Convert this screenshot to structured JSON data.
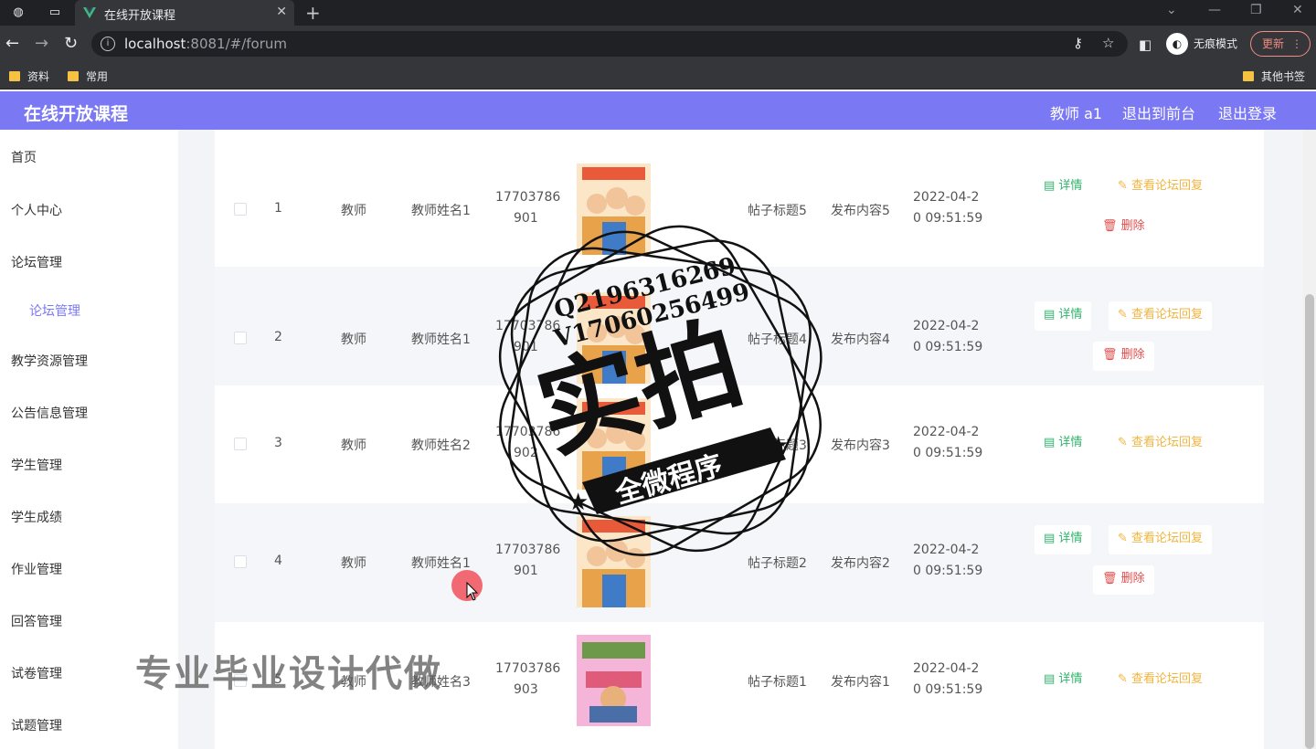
{
  "browser": {
    "tab_title": "在线开放课程",
    "url_host": "localhost",
    "url_rest": ":8081/#/forum",
    "incognito_label": "无痕模式",
    "update_label": "更新",
    "bookmarks": [
      "资料",
      "常用"
    ],
    "other_bookmarks": "其他书签"
  },
  "header": {
    "title": "在线开放课程",
    "user": "教师 a1",
    "to_front": "退出到前台",
    "logout": "退出登录"
  },
  "sidebar": {
    "items": [
      "首页",
      "个人中心",
      "论坛管理",
      "论坛管理",
      "教学资源管理",
      "公告信息管理",
      "学生管理",
      "学生成绩",
      "作业管理",
      "回答管理",
      "试卷管理",
      "试题管理"
    ]
  },
  "actions": {
    "detail": "详情",
    "reply": "查看论坛回复",
    "delete": "删除"
  },
  "rows": [
    {
      "idx": "1",
      "role": "教师",
      "name": "教师姓名1",
      "phone1": "17703786",
      "phone2": "901",
      "title": "帖子标题5",
      "content": "发布内容5",
      "time1": "2022-04-2",
      "time2": "0 09:51:59"
    },
    {
      "idx": "2",
      "role": "教师",
      "name": "教师姓名1",
      "phone1": "17703786",
      "phone2": "901",
      "title": "帖子标题4",
      "content": "发布内容4",
      "time1": "2022-04-2",
      "time2": "0 09:51:59"
    },
    {
      "idx": "3",
      "role": "教师",
      "name": "教师姓名2",
      "phone1": "17703786",
      "phone2": "902",
      "title": "帖子标题3",
      "content": "发布内容3",
      "time1": "2022-04-2",
      "time2": "0 09:51:59"
    },
    {
      "idx": "4",
      "role": "教师",
      "name": "教师姓名1",
      "phone1": "17703786",
      "phone2": "901",
      "title": "帖子标题2",
      "content": "发布内容2",
      "time1": "2022-04-2",
      "time2": "0 09:51:59"
    },
    {
      "idx": "5",
      "role": "教师",
      "name": "教师姓名3",
      "phone1": "17703786",
      "phone2": "903",
      "title": "帖子标题1",
      "content": "发布内容1",
      "time1": "2022-04-2",
      "time2": "0 09:51:59"
    }
  ],
  "stamp": {
    "q": "Q2196316269",
    "v": "V17060256499",
    "big": "实拍",
    "ribbon": "全微程序"
  },
  "watermark": "专业毕业设计代做"
}
